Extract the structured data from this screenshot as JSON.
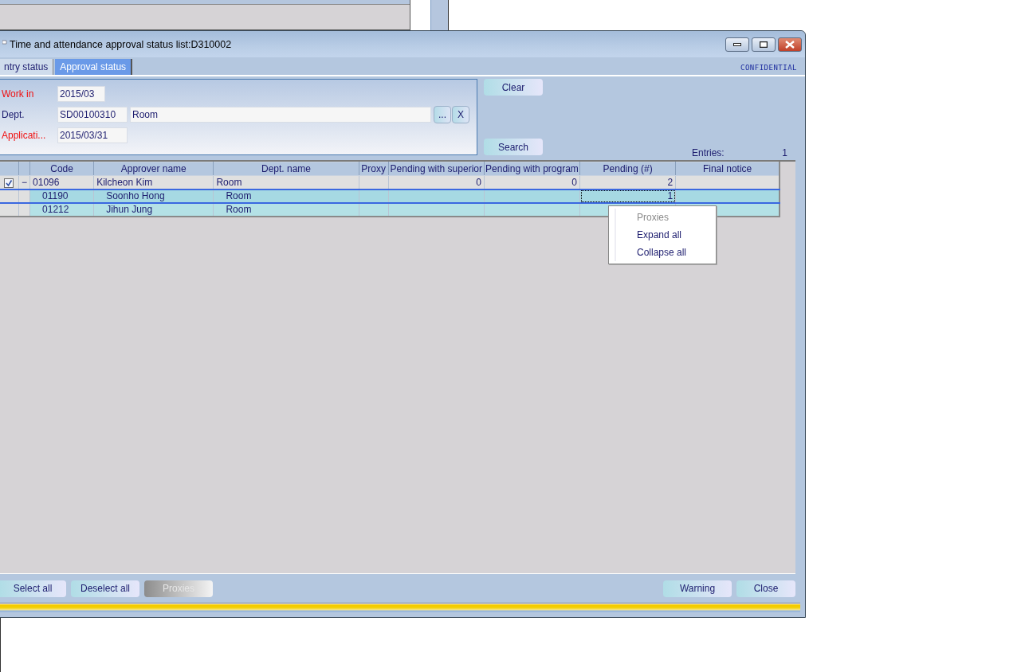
{
  "window": {
    "title": "Time and attendance approval status list:D310002"
  },
  "tabs": [
    {
      "label": "ntry status",
      "selected": false
    },
    {
      "label": "Approval status",
      "selected": true
    }
  ],
  "classification": "CONFIDENTIAL",
  "filters": [
    {
      "kind": "single",
      "label": "Work in",
      "required": true,
      "value": "2015/03"
    },
    {
      "kind": "lookup",
      "label": "Dept.",
      "required": false,
      "value": "SD00100310",
      "name": "Room",
      "browse": "...",
      "clear": "X"
    },
    {
      "kind": "single",
      "label": "Applicati...",
      "required": true,
      "value": "2015/03/31"
    }
  ],
  "clear_button": "Clear",
  "search_button": "Search",
  "entries": {
    "label": "Entries:",
    "value": "1"
  },
  "table": {
    "columns": [
      "Code",
      "Approver name",
      "Dept. name",
      "Proxy",
      "Pending with superior",
      "Pending with program",
      "Pending (#)",
      "Final notice"
    ],
    "rows": [
      {
        "checked": true,
        "expanded": true,
        "expander": "−",
        "selected": false,
        "code": "01096",
        "approver_name": "Kilcheon Kim",
        "dept_name": "Room",
        "pending_with_superior": "0",
        "pending_with_program": "0",
        "pending": "2",
        "children": [
          {
            "selected": true,
            "pending_focused": true,
            "code": "01190",
            "approver_name": "Soonho Hong",
            "dept_name": "Room",
            "pending": "1"
          },
          {
            "selected": false,
            "pending_focused": false,
            "code": "01212",
            "approver_name": "Jihun Jung",
            "dept_name": "Room"
          }
        ]
      }
    ]
  },
  "context_menu": [
    {
      "label": "Proxies",
      "disabled": true
    },
    {
      "label": "Expand all",
      "disabled": false
    },
    {
      "label": "Collapse all",
      "disabled": false
    }
  ],
  "footer_left": [
    {
      "label": "Select all",
      "disabled": false
    },
    {
      "label": "Deselect all",
      "disabled": false
    },
    {
      "label": "Proxies",
      "disabled": true
    }
  ],
  "footer_right": [
    {
      "label": "Warning",
      "disabled": false
    },
    {
      "label": "Close",
      "disabled": false
    }
  ]
}
